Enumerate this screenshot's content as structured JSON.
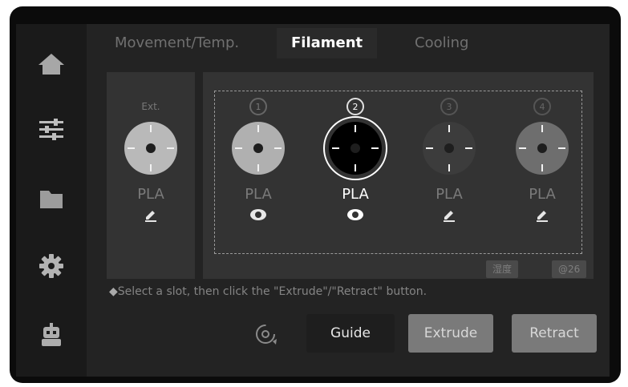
{
  "tabs": [
    {
      "label": "Movement/Temp.",
      "active": false
    },
    {
      "label": "Filament",
      "active": true
    },
    {
      "label": "Cooling",
      "active": false
    }
  ],
  "sidebar": {
    "items": [
      {
        "icon": "home-icon"
      },
      {
        "icon": "sliders-icon"
      },
      {
        "icon": "folder-icon"
      },
      {
        "icon": "gear-icon"
      },
      {
        "icon": "robot-icon"
      }
    ]
  },
  "external_slot": {
    "label": "Ext.",
    "type": "PLA",
    "spool_color": "#b9b9b9",
    "action_icon": "edit-icon"
  },
  "ams_slots": [
    {
      "number": "1",
      "type": "PLA",
      "spool_color": "#b0b0b0",
      "action_icon": "eye-icon",
      "selected": false
    },
    {
      "number": "2",
      "type": "PLA",
      "spool_color": "#000000",
      "action_icon": "eye-icon",
      "selected": true
    },
    {
      "number": "3",
      "type": "PLA",
      "spool_color": "#3c3c3c",
      "action_icon": "edit-icon",
      "selected": false
    },
    {
      "number": "4",
      "type": "PLA",
      "spool_color": "#6e6e6e",
      "action_icon": "edit-icon",
      "selected": false
    }
  ],
  "badges": {
    "humidity": "湿度",
    "temperature": "@26"
  },
  "hint": "Select a slot, then click the \"Extrude\"/\"Retract\" button.",
  "buttons": {
    "guide": "Guide",
    "extrude": "Extrude",
    "retract": "Retract"
  },
  "colors": {
    "background": "#232323",
    "panel": "#333333",
    "accent": "#ffffff",
    "button_disabled": "#7a7a7a"
  }
}
